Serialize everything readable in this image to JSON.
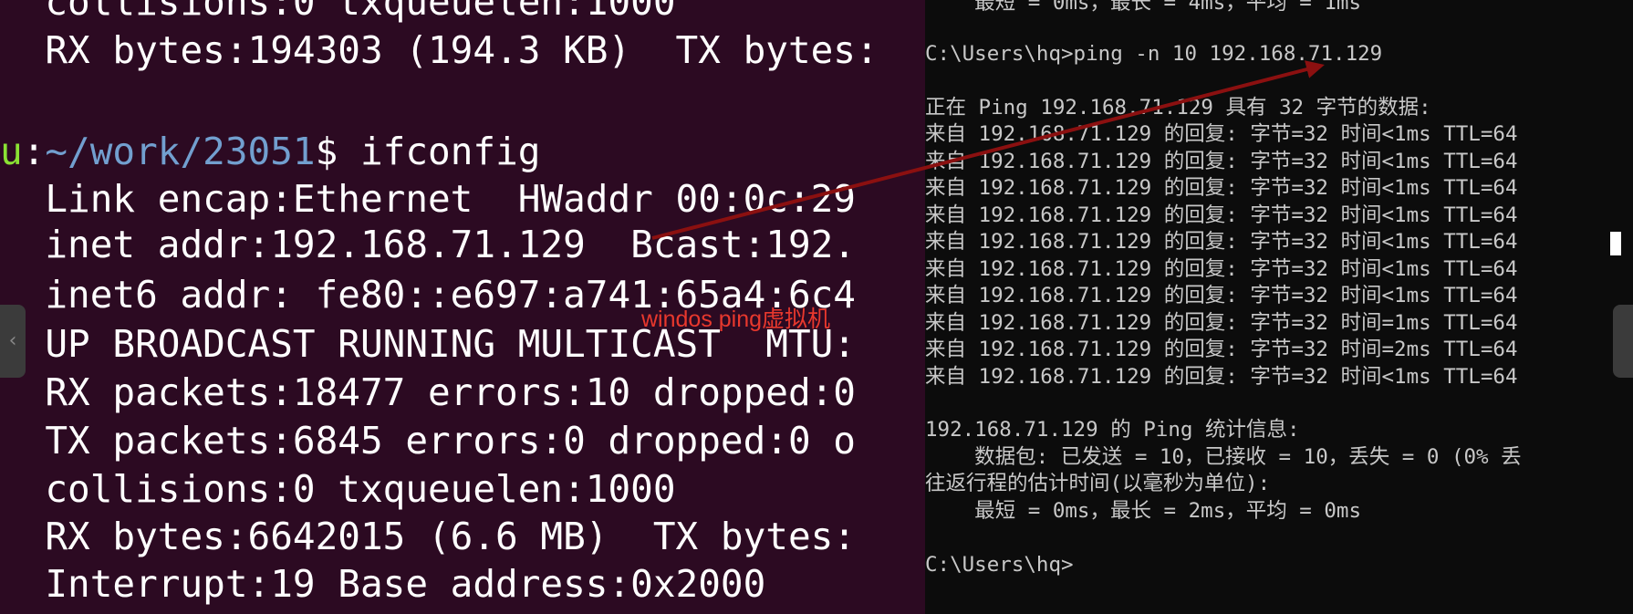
{
  "linux_terminal": {
    "lines": [
      "  collisions:0 txqueuelen:1000",
      "  RX bytes:194303 (194.3 KB)  TX bytes:",
      "",
      null,
      "  Link encap:Ethernet  HWaddr 00:0c:29",
      "  inet addr:192.168.71.129  Bcast:192.",
      "  inet6 addr: fe80::e697:a741:65a4:6c4",
      "  UP BROADCAST RUNNING MULTICAST  MTU:",
      "  RX packets:18477 errors:10 dropped:0",
      "  TX packets:6845 errors:0 dropped:0 o",
      "  collisions:0 txqueuelen:1000",
      "  RX bytes:6642015 (6.6 MB)  TX bytes:",
      "  Interrupt:19 Base address:0x2000"
    ],
    "prompt_user_tail": "u",
    "prompt_colon": ":",
    "prompt_path": "~/work/23051",
    "prompt_symbol": "$ ",
    "prompt_command": "ifconfig"
  },
  "windows_console": {
    "lines": [
      "    最短 = 0ms，最长 = 4ms，平均 = 1ms",
      "",
      "C:\\Users\\hq>ping -n 10 192.168.71.129",
      "",
      "正在 Ping 192.168.71.129 具有 32 字节的数据:",
      "来自 192.168.71.129 的回复: 字节=32 时间<1ms TTL=64",
      "来自 192.168.71.129 的回复: 字节=32 时间<1ms TTL=64",
      "来自 192.168.71.129 的回复: 字节=32 时间<1ms TTL=64",
      "来自 192.168.71.129 的回复: 字节=32 时间<1ms TTL=64",
      "来自 192.168.71.129 的回复: 字节=32 时间<1ms TTL=64",
      "来自 192.168.71.129 的回复: 字节=32 时间<1ms TTL=64",
      "来自 192.168.71.129 的回复: 字节=32 时间<1ms TTL=64",
      "来自 192.168.71.129 的回复: 字节=32 时间=1ms TTL=64",
      "来自 192.168.71.129 的回复: 字节=32 时间=2ms TTL=64",
      "来自 192.168.71.129 的回复: 字节=32 时间<1ms TTL=64",
      "",
      "192.168.71.129 的 Ping 统计信息:",
      "    数据包: 已发送 = 10，已接收 = 10，丢失 = 0 (0% 丢",
      "往返行程的估计时间(以毫秒为单位):",
      "    最短 = 0ms，最长 = 2ms，平均 = 0ms",
      "",
      "C:\\Users\\hq>"
    ]
  },
  "annotation": {
    "text": "windos ping虚拟机",
    "color": "#e8382d",
    "arrow_color": "#8b1010"
  },
  "colors": {
    "linux_bg": "#2c0a22",
    "windows_bg": "#0c0c0c",
    "prompt_user": "#8ae234",
    "prompt_path": "#729fcf"
  }
}
